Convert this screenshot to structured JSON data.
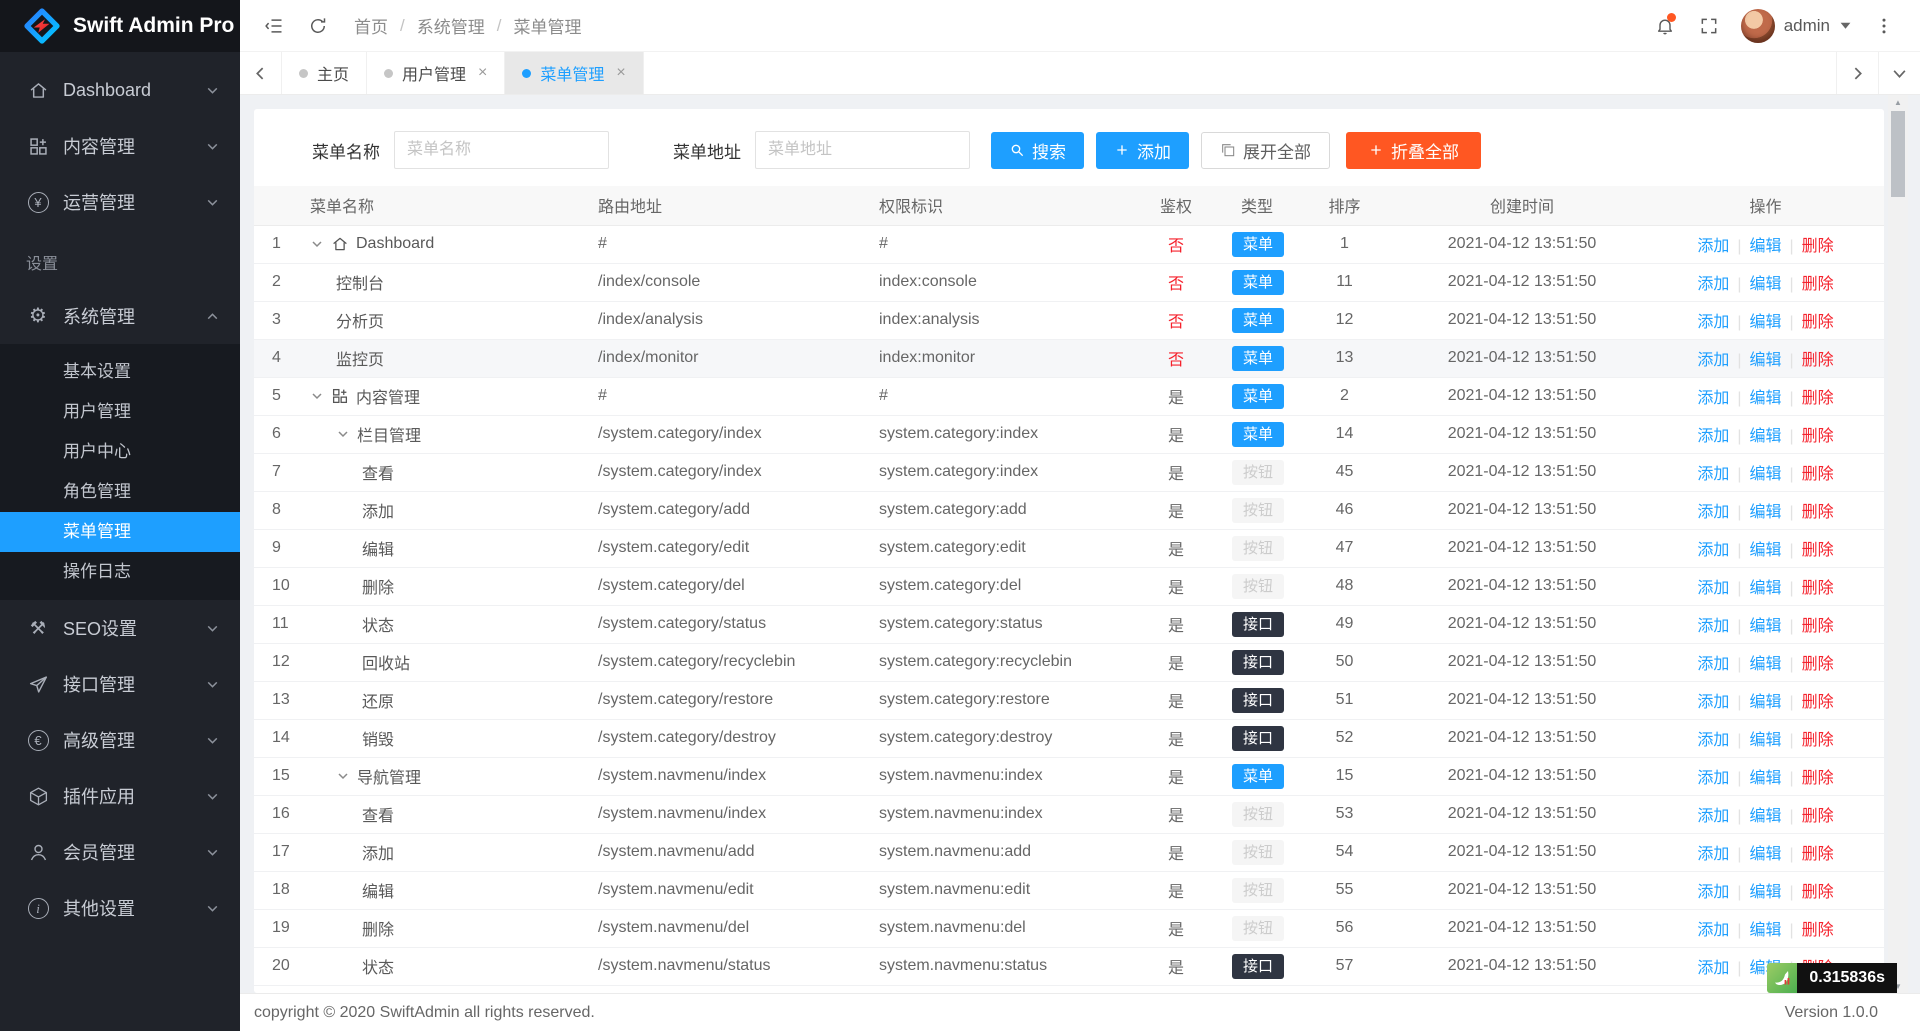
{
  "app": {
    "title": "Swift Admin Pro"
  },
  "header": {
    "breadcrumb": [
      "首页",
      "系统管理",
      "菜单管理"
    ],
    "user": "admin"
  },
  "tabs": [
    {
      "key": "home",
      "label": "主页",
      "active": false,
      "closable": false
    },
    {
      "key": "user-management",
      "label": "用户管理",
      "active": false,
      "closable": true
    },
    {
      "key": "menu-management",
      "label": "菜单管理",
      "active": true,
      "closable": true
    }
  ],
  "sidebar": {
    "section_label": "设置",
    "items": [
      {
        "type": "top",
        "key": "dashboard",
        "label": "Dashboard",
        "icon": "home",
        "expanded": false
      },
      {
        "type": "top",
        "key": "content-management",
        "label": "内容管理",
        "icon": "grid",
        "expanded": false
      },
      {
        "type": "top",
        "key": "operation-management",
        "label": "运营管理",
        "icon": "yen",
        "expanded": false
      },
      {
        "type": "section",
        "label": "设置"
      },
      {
        "type": "top",
        "key": "system-management",
        "label": "系统管理",
        "icon": "gear",
        "expanded": true
      },
      {
        "type": "sub",
        "key": "basic-settings",
        "label": "基本设置",
        "active": false
      },
      {
        "type": "sub",
        "key": "user-management",
        "label": "用户管理",
        "active": false
      },
      {
        "type": "sub",
        "key": "user-center",
        "label": "用户中心",
        "active": false
      },
      {
        "type": "sub",
        "key": "role-management",
        "label": "角色管理",
        "active": false
      },
      {
        "type": "sub",
        "key": "menu-management",
        "label": "菜单管理",
        "active": true
      },
      {
        "type": "sub",
        "key": "operation-log",
        "label": "操作日志",
        "active": false
      },
      {
        "type": "top",
        "key": "seo-settings",
        "label": "SEO设置",
        "icon": "tools",
        "expanded": false
      },
      {
        "type": "top",
        "key": "api-management",
        "label": "接口管理",
        "icon": "plane",
        "expanded": false
      },
      {
        "type": "top",
        "key": "advanced-management",
        "label": "高级管理",
        "icon": "euro",
        "expanded": false
      },
      {
        "type": "top",
        "key": "plugin-apps",
        "label": "插件应用",
        "icon": "cube",
        "expanded": false
      },
      {
        "type": "top",
        "key": "member-management",
        "label": "会员管理",
        "icon": "user",
        "expanded": false
      },
      {
        "type": "top",
        "key": "other-settings",
        "label": "其他设置",
        "icon": "info",
        "expanded": false
      }
    ]
  },
  "filter": {
    "name_label": "菜单名称",
    "name_placeholder": "菜单名称",
    "url_label": "菜单地址",
    "url_placeholder": "菜单地址",
    "search_label": "搜索",
    "add_label": "添加",
    "expand_label": "展开全部",
    "collapse_label": "折叠全部"
  },
  "table": {
    "headers": [
      "",
      "菜单名称",
      "路由地址",
      "权限标识",
      "鉴权",
      "类型",
      "排序",
      "创建时间",
      "操作"
    ],
    "ops": [
      "添加",
      "编辑",
      "删除"
    ],
    "rows": [
      {
        "id": 1,
        "name": "Dashboard",
        "icon": "home",
        "level": 0,
        "chevron": true,
        "route": "#",
        "perm": "#",
        "auth": "否",
        "type": "菜单",
        "sort": 1,
        "time": "2021-04-12 13:51:50"
      },
      {
        "id": 2,
        "name": "控制台",
        "level": 1,
        "chevron": false,
        "route": "/index/console",
        "perm": "index:console",
        "auth": "否",
        "type": "菜单",
        "sort": 11,
        "time": "2021-04-12 13:51:50"
      },
      {
        "id": 3,
        "name": "分析页",
        "level": 1,
        "chevron": false,
        "route": "/index/analysis",
        "perm": "index:analysis",
        "auth": "否",
        "type": "菜单",
        "sort": 12,
        "time": "2021-04-12 13:51:50"
      },
      {
        "id": 4,
        "name": "监控页",
        "level": 1,
        "chevron": false,
        "route": "/index/monitor",
        "perm": "index:monitor",
        "auth": "否",
        "type": "菜单",
        "sort": 13,
        "time": "2021-04-12 13:51:50",
        "hovered": true
      },
      {
        "id": 5,
        "name": "内容管理",
        "icon": "grid",
        "level": 0,
        "chevron": true,
        "route": "#",
        "perm": "#",
        "auth": "是",
        "type": "菜单",
        "sort": 2,
        "time": "2021-04-12 13:51:50"
      },
      {
        "id": 6,
        "name": "栏目管理",
        "level": 1,
        "chevron": true,
        "route": "/system.category/index",
        "perm": "system.category:index",
        "auth": "是",
        "type": "菜单",
        "sort": 14,
        "time": "2021-04-12 13:51:50"
      },
      {
        "id": 7,
        "name": "查看",
        "level": 2,
        "chevron": false,
        "route": "/system.category/index",
        "perm": "system.category:index",
        "auth": "是",
        "type": "按钮",
        "sort": 45,
        "time": "2021-04-12 13:51:50"
      },
      {
        "id": 8,
        "name": "添加",
        "level": 2,
        "chevron": false,
        "route": "/system.category/add",
        "perm": "system.category:add",
        "auth": "是",
        "type": "按钮",
        "sort": 46,
        "time": "2021-04-12 13:51:50"
      },
      {
        "id": 9,
        "name": "编辑",
        "level": 2,
        "chevron": false,
        "route": "/system.category/edit",
        "perm": "system.category:edit",
        "auth": "是",
        "type": "按钮",
        "sort": 47,
        "time": "2021-04-12 13:51:50"
      },
      {
        "id": 10,
        "name": "删除",
        "level": 2,
        "chevron": false,
        "route": "/system.category/del",
        "perm": "system.category:del",
        "auth": "是",
        "type": "按钮",
        "sort": 48,
        "time": "2021-04-12 13:51:50"
      },
      {
        "id": 11,
        "name": "状态",
        "level": 2,
        "chevron": false,
        "route": "/system.category/status",
        "perm": "system.category:status",
        "auth": "是",
        "type": "接口",
        "sort": 49,
        "time": "2021-04-12 13:51:50"
      },
      {
        "id": 12,
        "name": "回收站",
        "level": 2,
        "chevron": false,
        "route": "/system.category/recyclebin",
        "perm": "system.category:recyclebin",
        "auth": "是",
        "type": "接口",
        "sort": 50,
        "time": "2021-04-12 13:51:50"
      },
      {
        "id": 13,
        "name": "还原",
        "level": 2,
        "chevron": false,
        "route": "/system.category/restore",
        "perm": "system.category:restore",
        "auth": "是",
        "type": "接口",
        "sort": 51,
        "time": "2021-04-12 13:51:50"
      },
      {
        "id": 14,
        "name": "销毁",
        "level": 2,
        "chevron": false,
        "route": "/system.category/destroy",
        "perm": "system.category:destroy",
        "auth": "是",
        "type": "接口",
        "sort": 52,
        "time": "2021-04-12 13:51:50"
      },
      {
        "id": 15,
        "name": "导航管理",
        "level": 1,
        "chevron": true,
        "route": "/system.navmenu/index",
        "perm": "system.navmenu:index",
        "auth": "是",
        "type": "菜单",
        "sort": 15,
        "time": "2021-04-12 13:51:50"
      },
      {
        "id": 16,
        "name": "查看",
        "level": 2,
        "chevron": false,
        "route": "/system.navmenu/index",
        "perm": "system.navmenu:index",
        "auth": "是",
        "type": "按钮",
        "sort": 53,
        "time": "2021-04-12 13:51:50"
      },
      {
        "id": 17,
        "name": "添加",
        "level": 2,
        "chevron": false,
        "route": "/system.navmenu/add",
        "perm": "system.navmenu:add",
        "auth": "是",
        "type": "按钮",
        "sort": 54,
        "time": "2021-04-12 13:51:50"
      },
      {
        "id": 18,
        "name": "编辑",
        "level": 2,
        "chevron": false,
        "route": "/system.navmenu/edit",
        "perm": "system.navmenu:edit",
        "auth": "是",
        "type": "按钮",
        "sort": 55,
        "time": "2021-04-12 13:51:50"
      },
      {
        "id": 19,
        "name": "删除",
        "level": 2,
        "chevron": false,
        "route": "/system.navmenu/del",
        "perm": "system.navmenu:del",
        "auth": "是",
        "type": "按钮",
        "sort": 56,
        "time": "2021-04-12 13:51:50"
      },
      {
        "id": 20,
        "name": "状态",
        "level": 2,
        "chevron": false,
        "route": "/system.navmenu/status",
        "perm": "system.navmenu:status",
        "auth": "是",
        "type": "接口",
        "sort": 57,
        "time": "2021-04-12 13:51:50"
      }
    ]
  },
  "footer": {
    "copyright": "copyright © 2020 SwiftAdmin all rights reserved.",
    "version": "Version 1.0.0"
  },
  "debug": {
    "time": "0.315836s"
  },
  "colors": {
    "accent": "#1e9fff",
    "warn": "#ff5722",
    "danger": "#f5222d",
    "api_badge": "#2f3542",
    "sidebar_bg": "#20232a"
  }
}
